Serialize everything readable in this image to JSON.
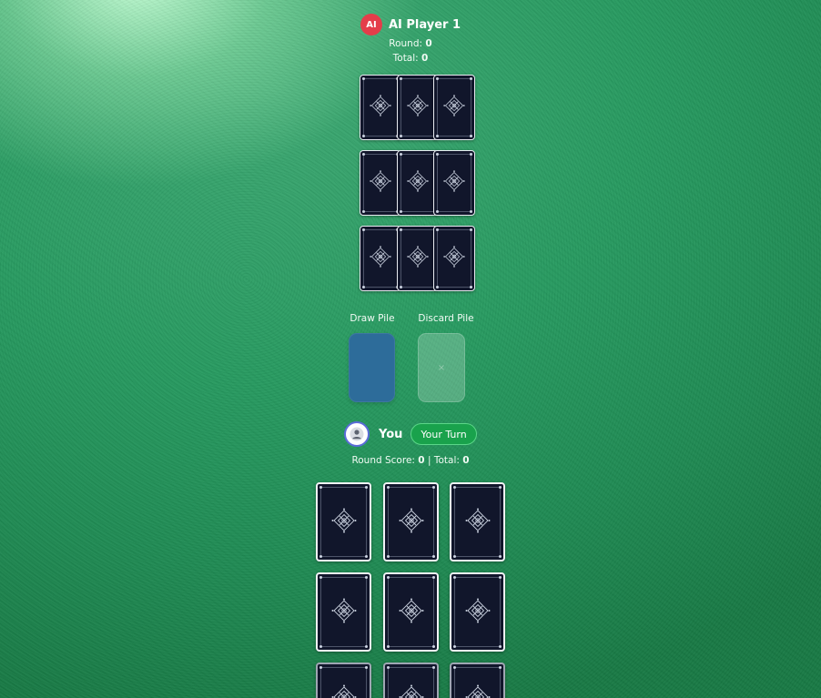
{
  "opponent": {
    "avatar_text": "AI",
    "name": "AI Player 1",
    "round_label": "Round:",
    "round_value": "0",
    "total_label": "Total:",
    "total_value": "0"
  },
  "piles": {
    "draw_label": "Draw Pile",
    "discard_label": "Discard Pile",
    "discard_placeholder": "×"
  },
  "player": {
    "name": "You",
    "turn_badge": "Your Turn",
    "round_score_label": "Round Score:",
    "round_score_value": "0",
    "separator": "|",
    "total_label": "Total:",
    "total_value": "0"
  },
  "colors": {
    "card_back": "#11162b",
    "draw_pile": "#2d6c9a",
    "turn_badge": "#19a24c",
    "ai_avatar": "#e43d4a"
  },
  "icons": {
    "card_back_emblem": "ornament-diamond-icon",
    "user_avatar": "person-icon"
  }
}
